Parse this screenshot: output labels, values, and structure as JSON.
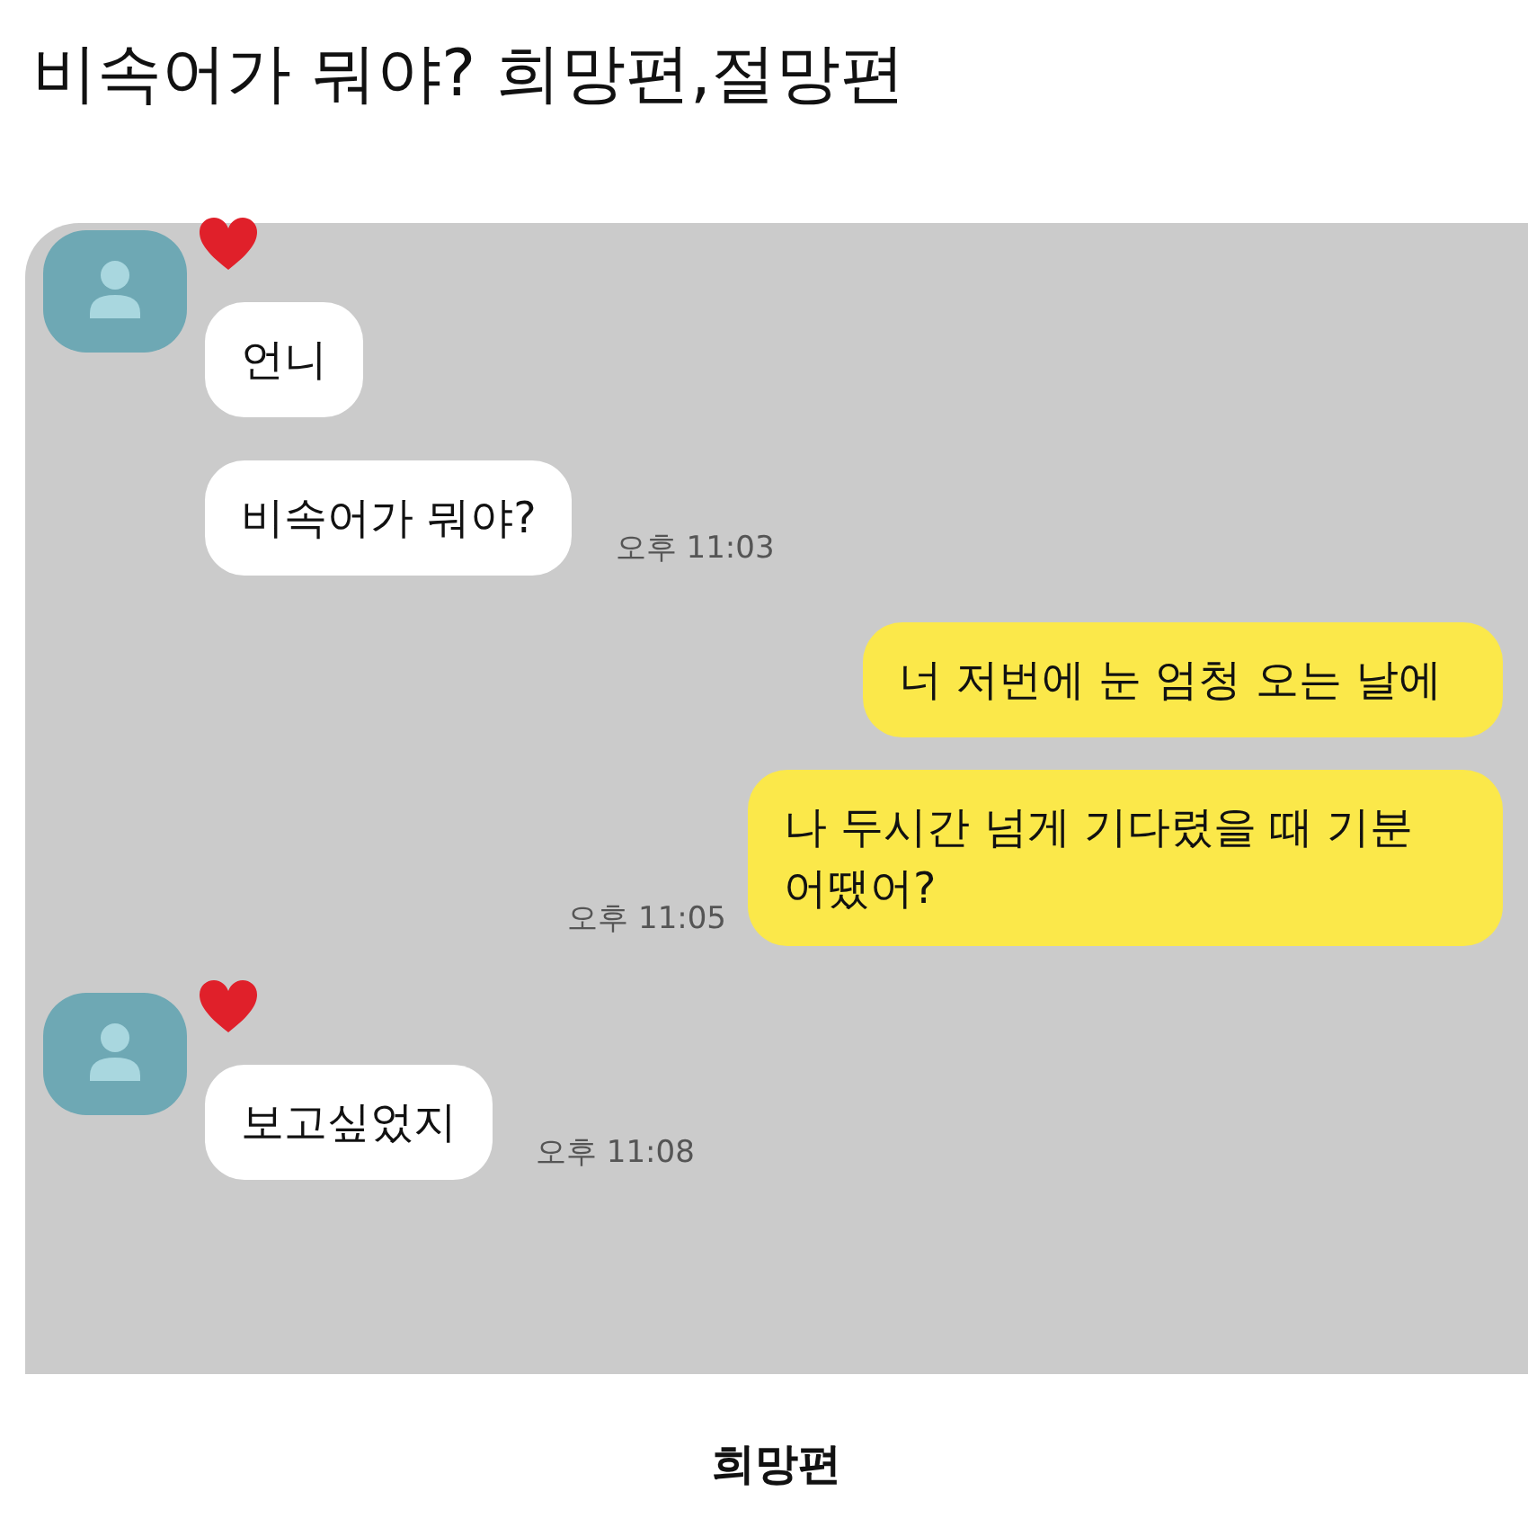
{
  "title": "비속어가 뭐야? 희망편,절망편",
  "chat": {
    "groups": [
      {
        "kind": "incoming",
        "messages": [
          "언니",
          "비속어가 뭐야?"
        ],
        "time": "오후 11:03"
      },
      {
        "kind": "outgoing",
        "messages": [
          "너 저번에 눈 엄청 오는 날에",
          "나 두시간 넘게 기다렸을 때 기분 어땠어?"
        ],
        "time": "오후 11:05"
      },
      {
        "kind": "incoming",
        "messages": [
          "보고싶었지"
        ],
        "time": "오후 11:08"
      }
    ]
  },
  "caption": "희망편"
}
